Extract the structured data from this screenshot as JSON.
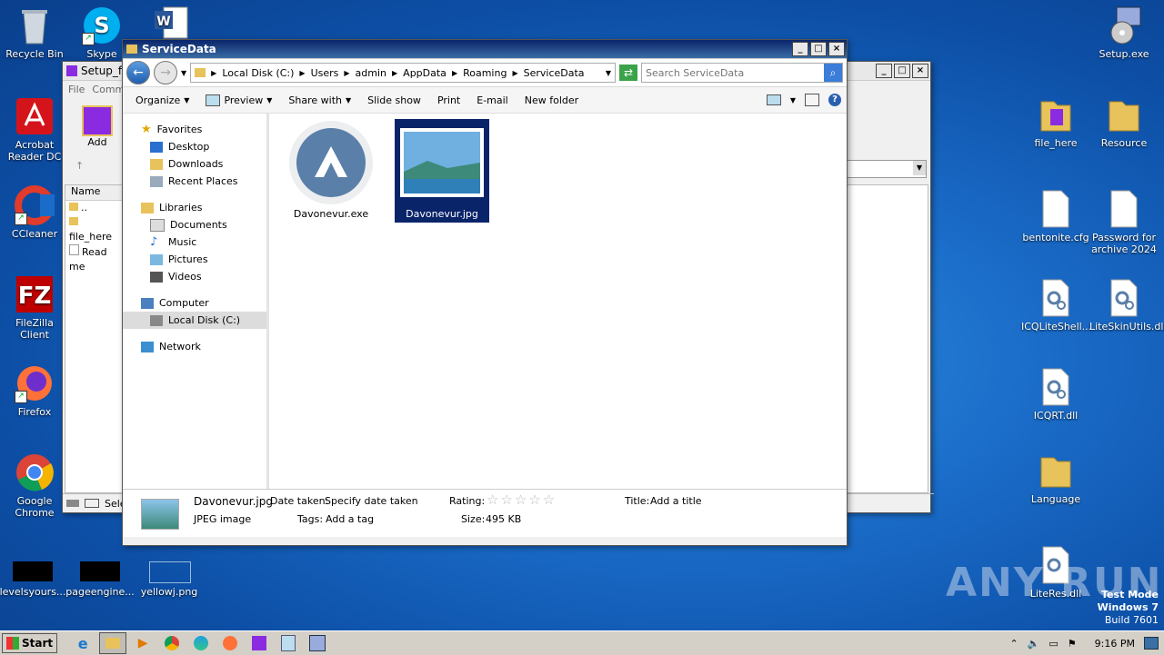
{
  "desktop": {
    "left_icons": [
      {
        "label": "Recycle Bin",
        "icon": "recycle-bin-icon"
      },
      {
        "label": "Skype",
        "icon": "skype-icon"
      },
      {
        "label": "Acrobat Reader DC",
        "icon": "acrobat-icon"
      },
      {
        "label": "CCleaner",
        "icon": "ccleaner-icon"
      },
      {
        "label": "FileZilla Client",
        "icon": "filezilla-icon"
      },
      {
        "label": "Firefox",
        "icon": "firefox-icon"
      },
      {
        "label": "Google Chrome",
        "icon": "chrome-icon"
      },
      {
        "label": "levelsyours...",
        "icon": "black-file-icon"
      },
      {
        "label": "pageengine...",
        "icon": "black-file-icon"
      },
      {
        "label": "yellowj.png",
        "icon": "image-file-icon"
      }
    ],
    "right_icons": [
      {
        "label": "Setup.exe",
        "icon": "setup-icon"
      },
      {
        "label": "file_here",
        "icon": "folder-archive-icon"
      },
      {
        "label": "Resource",
        "icon": "folder-icon"
      },
      {
        "label": "bentonite.cfg",
        "icon": "blank-file-icon"
      },
      {
        "label": "Password for archive 2024",
        "icon": "blank-file-icon"
      },
      {
        "label": "ICQLiteShell...",
        "icon": "dll-icon"
      },
      {
        "label": "LiteSkinUtils.dll",
        "icon": "dll-icon"
      },
      {
        "label": "ICQRT.dll",
        "icon": "dll-icon"
      },
      {
        "label": "Language",
        "icon": "folder-icon"
      },
      {
        "label": "LiteRes.dll",
        "icon": "dll-icon"
      }
    ]
  },
  "bg_window": {
    "title": "Setup_f",
    "menu": [
      "File",
      "Comm"
    ],
    "add_label": "Add",
    "col_name": "Name",
    "rows": [
      "..",
      "file_here",
      "Read me"
    ],
    "status": "Sele"
  },
  "explorer": {
    "title": "ServiceData",
    "breadcrumb": [
      "Local Disk (C:)",
      "Users",
      "admin",
      "AppData",
      "Roaming",
      "ServiceData"
    ],
    "search_placeholder": "Search ServiceData",
    "toolbar": {
      "organize": "Organize",
      "preview": "Preview",
      "share": "Share with",
      "slideshow": "Slide show",
      "print": "Print",
      "email": "E-mail",
      "newfolder": "New folder"
    },
    "nav": {
      "favorites": "Favorites",
      "desktop": "Desktop",
      "downloads": "Downloads",
      "recent": "Recent Places",
      "libraries": "Libraries",
      "documents": "Documents",
      "music": "Music",
      "pictures": "Pictures",
      "videos": "Videos",
      "computer": "Computer",
      "localdisk": "Local Disk (C:)",
      "network": "Network"
    },
    "files": [
      {
        "name": "Davonevur.exe",
        "selected": false
      },
      {
        "name": "Davonevur.jpg",
        "selected": true
      }
    ],
    "details": {
      "filename": "Davonevur.jpg",
      "type": "JPEG image",
      "date_label": "Date taken:",
      "date_value": "Specify date taken",
      "tags_label": "Tags:",
      "tags_value": "Add a tag",
      "rating_label": "Rating:",
      "rating_stars": 0,
      "size_label": "Size:",
      "size_value": "495 KB",
      "title_label": "Title:",
      "title_value": "Add a title"
    }
  },
  "taskbar": {
    "start": "Start",
    "time": "9:16 PM"
  },
  "watermark": "ANY RUN",
  "testmode": {
    "line1": "Test Mode",
    "line2": "Windows 7",
    "line3": "Build 7601"
  }
}
